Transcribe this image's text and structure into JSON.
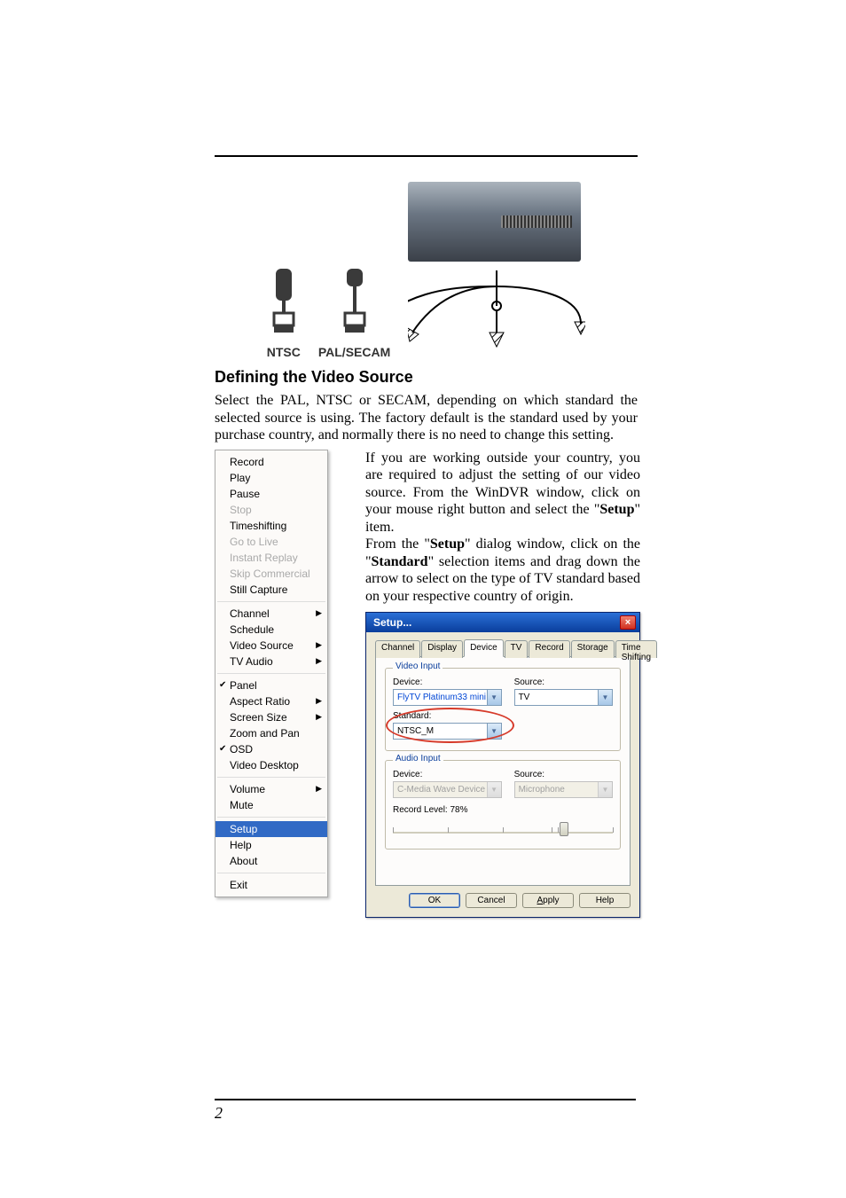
{
  "page_number": "2",
  "figure": {
    "labels": {
      "ntsc": "NTSC",
      "palsecam": "PAL/SECAM"
    }
  },
  "heading": "Defining the Video Source",
  "paragraphs": {
    "p1": "Select the PAL, NTSC or SECAM, depending on which standard the selected source is using.  The factory default is the standard used by your purchase country, and normally there is no need to change this setting.",
    "p2a": "If you are working outside your country, you are required to adjust the setting of our video source.  From the WinDVR window, click on your mouse right button and select the \"",
    "p2b": "Setup",
    "p2c": "\" item.",
    "p3a": "From the \"",
    "p3b": "Setup",
    "p3c": "\" dialog window, click on the \"",
    "p3d": "Standard",
    "p3e": "\" selection items and drag down the arrow to select on the type of TV standard based on your respective country of origin."
  },
  "context_menu": {
    "groups": [
      [
        {
          "label": "Record",
          "disabled": false,
          "arrow": false,
          "check": false,
          "highlight": false
        },
        {
          "label": "Play",
          "disabled": false,
          "arrow": false,
          "check": false,
          "highlight": false
        },
        {
          "label": "Pause",
          "disabled": false,
          "arrow": false,
          "check": false,
          "highlight": false
        },
        {
          "label": "Stop",
          "disabled": true,
          "arrow": false,
          "check": false,
          "highlight": false
        },
        {
          "label": "Timeshifting",
          "disabled": false,
          "arrow": false,
          "check": false,
          "highlight": false
        },
        {
          "label": "Go to Live",
          "disabled": true,
          "arrow": false,
          "check": false,
          "highlight": false
        },
        {
          "label": "Instant Replay",
          "disabled": true,
          "arrow": false,
          "check": false,
          "highlight": false
        },
        {
          "label": "Skip Commercial",
          "disabled": true,
          "arrow": false,
          "check": false,
          "highlight": false
        },
        {
          "label": "Still Capture",
          "disabled": false,
          "arrow": false,
          "check": false,
          "highlight": false
        }
      ],
      [
        {
          "label": "Channel",
          "disabled": false,
          "arrow": true,
          "check": false,
          "highlight": false
        },
        {
          "label": "Schedule",
          "disabled": false,
          "arrow": false,
          "check": false,
          "highlight": false
        },
        {
          "label": "Video Source",
          "disabled": false,
          "arrow": true,
          "check": false,
          "highlight": false
        },
        {
          "label": "TV Audio",
          "disabled": false,
          "arrow": true,
          "check": false,
          "highlight": false
        }
      ],
      [
        {
          "label": "Panel",
          "disabled": false,
          "arrow": false,
          "check": true,
          "highlight": false
        },
        {
          "label": "Aspect Ratio",
          "disabled": false,
          "arrow": true,
          "check": false,
          "highlight": false
        },
        {
          "label": "Screen Size",
          "disabled": false,
          "arrow": true,
          "check": false,
          "highlight": false
        },
        {
          "label": "Zoom and Pan",
          "disabled": false,
          "arrow": false,
          "check": false,
          "highlight": false
        },
        {
          "label": "OSD",
          "disabled": false,
          "arrow": false,
          "check": true,
          "highlight": false
        },
        {
          "label": "Video Desktop",
          "disabled": false,
          "arrow": false,
          "check": false,
          "highlight": false
        }
      ],
      [
        {
          "label": "Volume",
          "disabled": false,
          "arrow": true,
          "check": false,
          "highlight": false
        },
        {
          "label": "Mute",
          "disabled": false,
          "arrow": false,
          "check": false,
          "highlight": false
        }
      ],
      [
        {
          "label": "Setup",
          "disabled": false,
          "arrow": false,
          "check": false,
          "highlight": true
        },
        {
          "label": "Help",
          "disabled": false,
          "arrow": false,
          "check": false,
          "highlight": false
        },
        {
          "label": "About",
          "disabled": false,
          "arrow": false,
          "check": false,
          "highlight": false
        }
      ],
      [
        {
          "label": "Exit",
          "disabled": false,
          "arrow": false,
          "check": false,
          "highlight": false
        }
      ]
    ]
  },
  "setup_dialog": {
    "title": "Setup...",
    "tabs": [
      "Channel",
      "Display",
      "Device",
      "TV",
      "Record",
      "Storage",
      "Time Shifting"
    ],
    "active_tab": "Device",
    "video_input": {
      "legend": "Video Input",
      "device_label": "Device:",
      "device_value": "FlyTV Platinum33 mini",
      "source_label": "Source:",
      "source_value": "TV",
      "standard_label": "Standard:",
      "standard_value": "NTSC_M"
    },
    "audio_input": {
      "legend": "Audio Input",
      "device_label": "Device:",
      "device_value": "C-Media Wave Device",
      "source_label": "Source:",
      "source_value": "Microphone",
      "record_level_label": "Record Level: 78%",
      "record_level_percent": 78
    },
    "buttons": {
      "ok": "OK",
      "cancel": "Cancel",
      "apply": "Apply",
      "help": "Help"
    }
  },
  "colors": {
    "titlebar_blue": "#0a3e9c",
    "highlight_blue": "#316ac5",
    "circle_red": "#d63a2a"
  }
}
